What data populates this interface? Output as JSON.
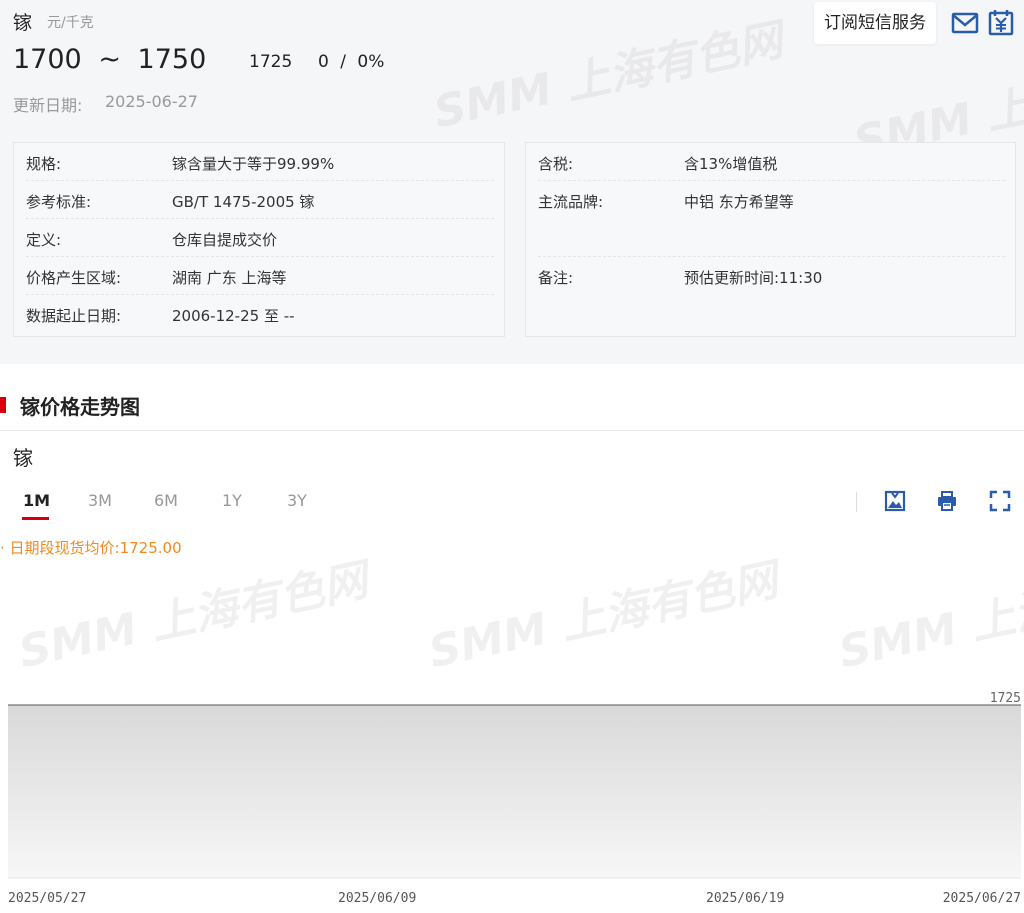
{
  "header": {
    "name": "镓",
    "unit": "元/千克",
    "price_low": "1700",
    "tilde": "~",
    "price_high": "1750",
    "avg_price": "1725",
    "change": "0",
    "slash": "/",
    "change_pct": "0%",
    "update_label": "更新日期:",
    "update_date": "2025-06-27",
    "subscribe_label": "订阅短信服务",
    "watermark": "SMM 上海有色网"
  },
  "info_left": [
    {
      "label": "规格:",
      "value": "镓含量大于等于99.99%"
    },
    {
      "label": "参考标准:",
      "value": "GB/T 1475-2005 镓"
    },
    {
      "label": "定义:",
      "value": "仓库自提成交价"
    },
    {
      "label": "价格产生区域:",
      "value": "湖南 广东 上海等"
    },
    {
      "label": "数据起止日期:",
      "value": "2006-12-25 至 --"
    }
  ],
  "info_right": [
    {
      "label": "含税:",
      "value": "含13%增值税"
    },
    {
      "label": "主流品牌:",
      "value": "中铝 东方希望等"
    },
    {
      "label": "备注:",
      "value": "预估更新时间:11:30"
    }
  ],
  "section": {
    "title": "镓价格走势图"
  },
  "chart_panel": {
    "title": "镓",
    "tabs": [
      "1M",
      "3M",
      "6M",
      "1Y",
      "3Y"
    ],
    "active_tab": "1M",
    "avg_legend": "· 日期段现货均价:1725.00"
  },
  "colors": {
    "accent_red": "#d6000f",
    "legend_orange": "#f08a1e",
    "icon_blue": "#2a5caa"
  },
  "icons": {
    "mail": "mail-icon",
    "price": "yuan-calendar-icon",
    "save_image": "image-download-icon",
    "print": "print-icon",
    "fullscreen": "fullscreen-icon"
  },
  "chart_data": {
    "type": "area",
    "x": [
      "2025/05/27",
      "2025/06/09",
      "2025/06/19",
      "2025/06/27"
    ],
    "x_tick_labels": [
      "2025/05/27",
      "2025/06/09",
      "2025/06/19",
      "2025/06/27"
    ],
    "values": [
      1725,
      1725,
      1725,
      1725
    ],
    "y_tick_labels": [
      "1725"
    ],
    "title": "镓",
    "xlabel": "",
    "ylabel": "",
    "grid": false,
    "legend": "none"
  }
}
